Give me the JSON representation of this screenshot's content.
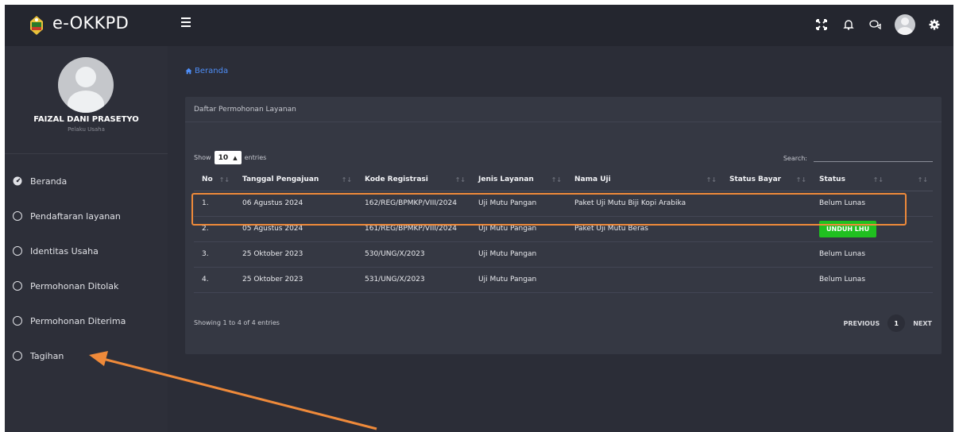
{
  "app": {
    "brand": "e-OKKPD"
  },
  "profile": {
    "name": "FAIZAL DANI PRASETYO",
    "role": "Pelaku Usaha"
  },
  "nav": [
    {
      "label": "Beranda",
      "icon": "dashboard-icon"
    },
    {
      "label": "Pendaftaran layanan",
      "icon": "circle-icon"
    },
    {
      "label": "Identitas Usaha",
      "icon": "circle-icon"
    },
    {
      "label": "Permohonan Ditolak",
      "icon": "circle-icon"
    },
    {
      "label": "Permohonan Diterima",
      "icon": "circle-icon"
    },
    {
      "label": "Tagihan",
      "icon": "circle-icon"
    }
  ],
  "breadcrumb": {
    "label": "Beranda"
  },
  "card": {
    "title": "Daftar Permohonan Layanan"
  },
  "table_controls": {
    "show": "Show",
    "length": "10",
    "entries": "entries",
    "search_label": "Search:",
    "search_value": ""
  },
  "table": {
    "headers": [
      "No",
      "Tanggal Pengajuan",
      "Kode Registrasi",
      "Jenis Layanan",
      "Nama Uji",
      "Status Bayar",
      "Status",
      ""
    ],
    "rows": [
      {
        "no": "1.",
        "tanggal": "06 Agustus 2024",
        "kode": "162/REG/BPMKP/VIII/2024",
        "jenis": "Uji Mutu Pangan",
        "nama": "Paket Uji Mutu Biji Kopi Arabika",
        "bayar": "",
        "status": "Belum Lunas"
      },
      {
        "no": "2.",
        "tanggal": "05 Agustus 2024",
        "kode": "161/REG/BPMKP/VIII/2024",
        "jenis": "Uji Mutu Pangan",
        "nama": "Paket Uji Mutu Beras",
        "bayar": "",
        "status": "UNDUH LHU"
      },
      {
        "no": "3.",
        "tanggal": "25 Oktober 2023",
        "kode": "530/UNG/X/2023",
        "jenis": "Uji Mutu Pangan",
        "nama": "",
        "bayar": "",
        "status": "Belum Lunas"
      },
      {
        "no": "4.",
        "tanggal": "25 Oktober 2023",
        "kode": "531/UNG/X/2023",
        "jenis": "Uji Mutu Pangan",
        "nama": "",
        "bayar": "",
        "status": "Belum Lunas"
      }
    ]
  },
  "footer": {
    "info": "Showing 1 to 4 of 4 entries",
    "previous": "PREVIOUS",
    "page": "1",
    "next": "NEXT"
  },
  "colors": {
    "accent_link": "#4e8ef7",
    "annotation": "#ef8a3a",
    "download_button": "#20c020"
  }
}
